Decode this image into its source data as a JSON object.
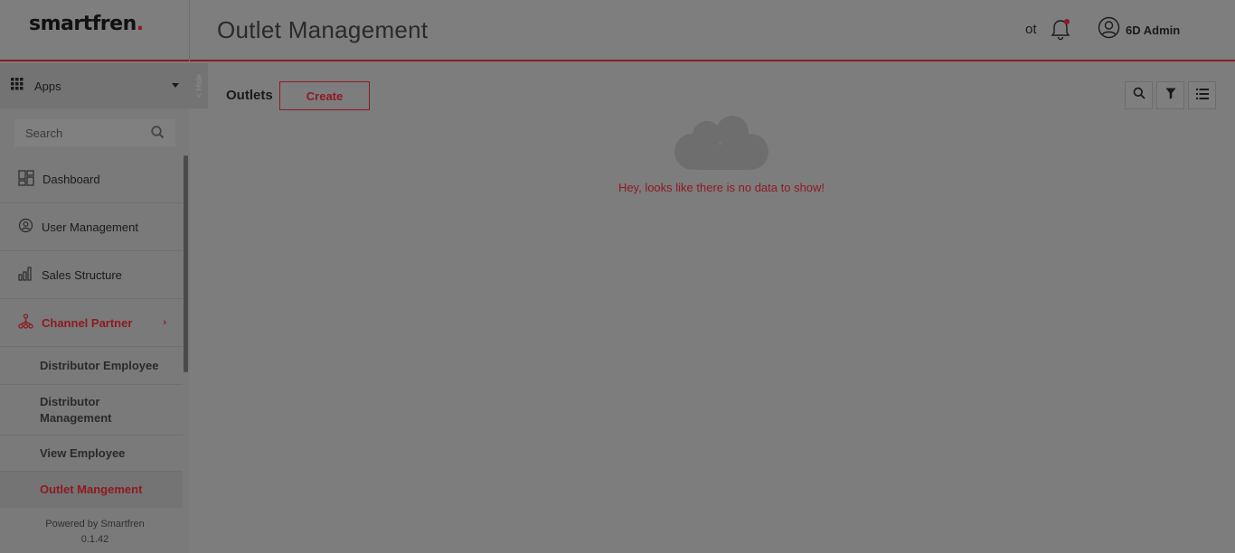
{
  "header": {
    "brand": "smartfren",
    "brand_dot": ".",
    "page_title": "Outlet Management",
    "status_text": "ot",
    "user_name": "6D Admin",
    "accent_color": "#8e1a22"
  },
  "sidebar": {
    "apps_label": "Apps",
    "hide_label": "< Hide",
    "search_placeholder": "Search",
    "items": [
      {
        "label": "Dashboard",
        "icon": "dashboard-icon"
      },
      {
        "label": "User Management",
        "icon": "user-gear-icon"
      },
      {
        "label": "Sales Structure",
        "icon": "bar-chart-icon"
      },
      {
        "label": "Channel Partner",
        "icon": "network-icon",
        "active": true
      }
    ],
    "sub_items": [
      {
        "label": "Distributor Employee"
      },
      {
        "label": "Distributor Management"
      },
      {
        "label": "View Employee"
      },
      {
        "label": "Outlet Mangement",
        "selected": true
      }
    ],
    "powered_by": "Powered by Smartfren",
    "version": "0.1.42"
  },
  "main": {
    "section_label": "Outlets",
    "create_label": "Create",
    "empty_message": "Hey, looks like there is no data to show!"
  }
}
